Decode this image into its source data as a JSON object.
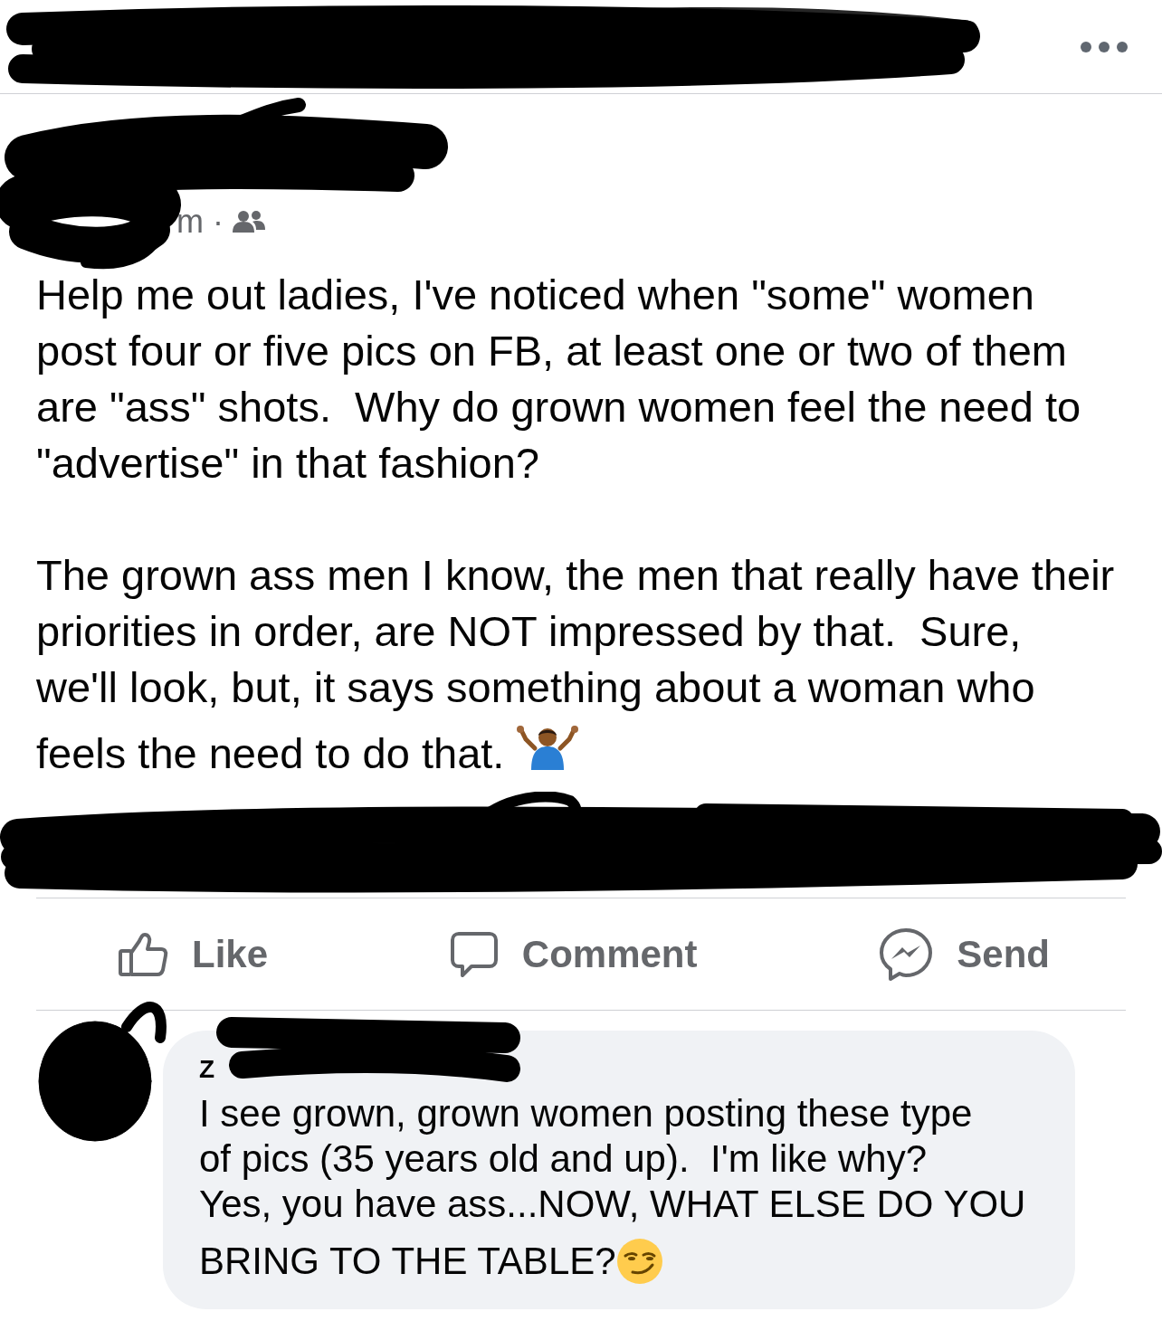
{
  "post": {
    "time": "m",
    "separator": "·",
    "paragraphs": [
      {
        "text": "Help me out ladies, I've noticed when \"some\" women\npost four or five pics on FB, at least one or two of them\nare \"ass\" shots.  Why do grown women feel the need to\n\"advertise\" in that fashion?"
      },
      {
        "text": "The grown ass men I know, the men that really have their\npriorities in order, are NOT impressed by that.  Sure,\nwe'll look, but, it says something about a woman who",
        "last_line": "feels the need to do that."
      }
    ]
  },
  "actions": [
    {
      "kind": "like",
      "label": "Like"
    },
    {
      "kind": "comment",
      "label": "Comment"
    },
    {
      "kind": "send",
      "label": "Send"
    }
  ],
  "comment": {
    "author": "Z",
    "text": "I see grown, grown women posting these type\nof pics (35 years old and up).  I'm like why?\nYes, you have ass...NOW, WHAT ELSE DO YOU",
    "last_line": "BRING TO THE TABLE?"
  }
}
